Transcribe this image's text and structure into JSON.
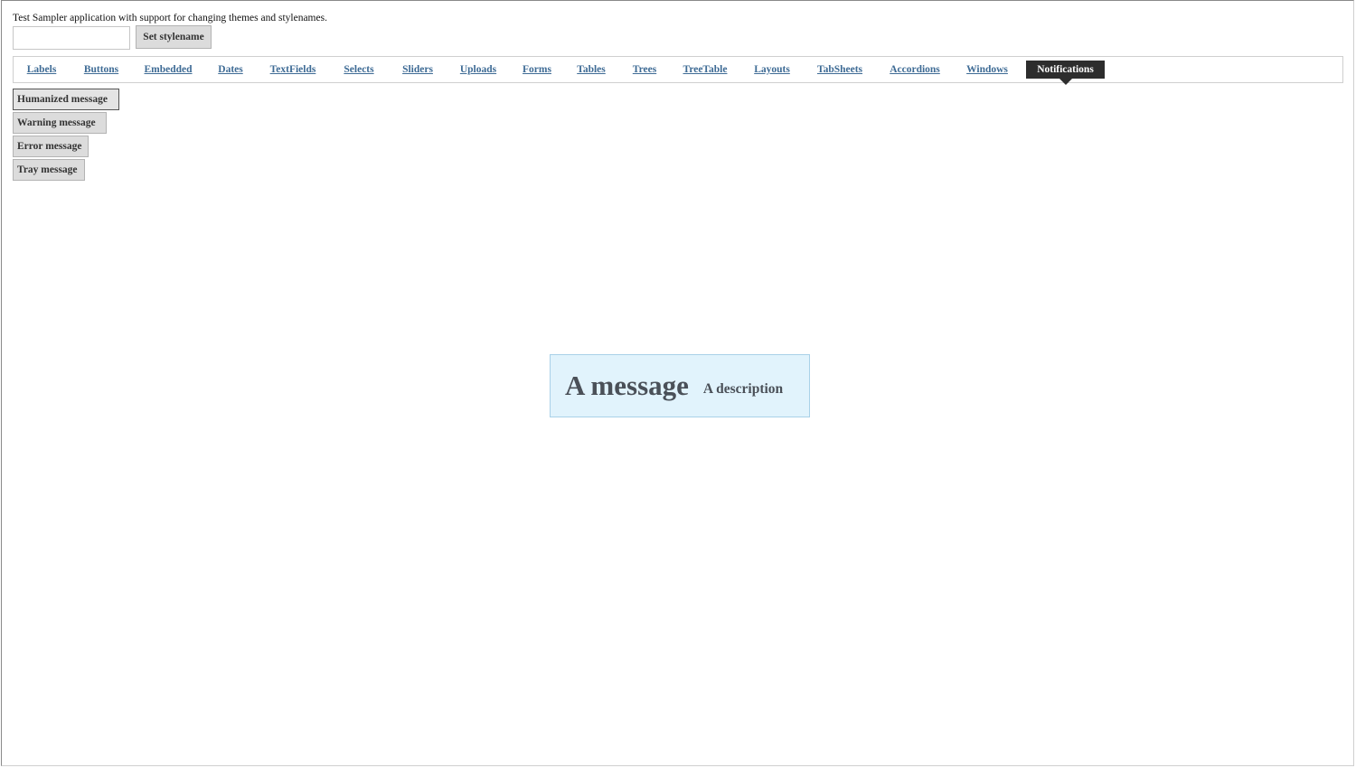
{
  "header": {
    "intro_text": "Test Sampler application with support for changing themes and stylenames.",
    "stylename_input": {
      "value": "",
      "placeholder": ""
    },
    "set_stylename_label": "Set stylename"
  },
  "tabs": [
    {
      "id": "labels",
      "label": "Labels"
    },
    {
      "id": "buttons",
      "label": "Buttons"
    },
    {
      "id": "embedded",
      "label": "Embedded"
    },
    {
      "id": "dates",
      "label": "Dates"
    },
    {
      "id": "textfields",
      "label": "TextFields"
    },
    {
      "id": "selects",
      "label": "Selects"
    },
    {
      "id": "sliders",
      "label": "Sliders"
    },
    {
      "id": "uploads",
      "label": "Uploads"
    },
    {
      "id": "forms",
      "label": "Forms"
    },
    {
      "id": "tables",
      "label": "Tables"
    },
    {
      "id": "trees",
      "label": "Trees"
    },
    {
      "id": "treetable",
      "label": "TreeTable"
    },
    {
      "id": "layouts",
      "label": "Layouts"
    },
    {
      "id": "tabsheets",
      "label": "TabSheets"
    },
    {
      "id": "accordions",
      "label": "Accordions"
    },
    {
      "id": "windows",
      "label": "Windows"
    },
    {
      "id": "notifications",
      "label": "Notifications",
      "selected": true
    }
  ],
  "notifications_panel": {
    "buttons": [
      {
        "id": "humanized",
        "label": "Humanized message",
        "focused": true
      },
      {
        "id": "warning",
        "label": "Warning message"
      },
      {
        "id": "error",
        "label": "Error message"
      },
      {
        "id": "tray",
        "label": "Tray message"
      }
    ]
  },
  "notification": {
    "caption": "A message",
    "description": "A description",
    "background_color": "#e1f3fc",
    "border_color": "#a9d1e8"
  },
  "colors": {
    "tab_link": "#3e6b95",
    "tab_selected_bg": "#2d2d2d",
    "button_bg": "#dcdcdc"
  }
}
